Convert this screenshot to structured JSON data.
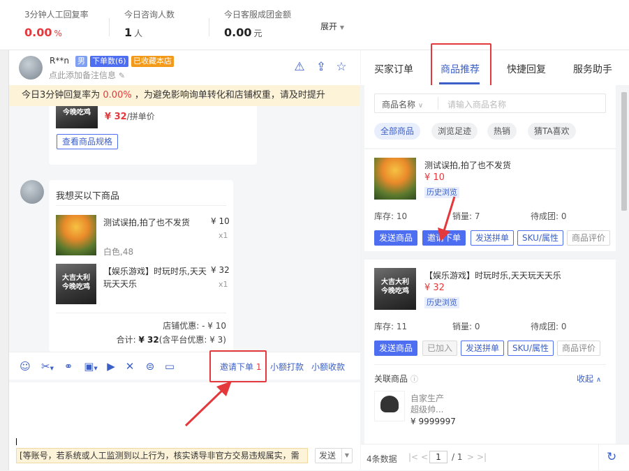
{
  "stats": [
    {
      "label": "3分钟人工回复率",
      "value": "0.00",
      "unit": "%"
    },
    {
      "label": "今日咨询人数",
      "value": "1",
      "unit": "人"
    },
    {
      "label": "今日客服成团金额",
      "value": "0.00",
      "unit": "元"
    }
  ],
  "expand_label": "展开",
  "chat": {
    "username": "R**n",
    "tags": {
      "gender": "男",
      "orders": "下单数(6)",
      "fav": "已收藏本店"
    },
    "note_placeholder": "点此添加备注信息",
    "warning": {
      "prefix": "今日3分钟回复率为 ",
      "rate": "0.00%",
      "suffix": " ，为避免影响询单转化和店铺权重，请及时提升"
    },
    "prev_card": {
      "price": "¥ 32",
      "price_suffix": "/拼单价",
      "spec_btn": "查看商品规格"
    },
    "order_msg": {
      "title": "我想买以下商品",
      "items": [
        {
          "name": "测试误拍,拍了也不发货",
          "price": "¥ 10",
          "qty": "x1",
          "sku": "白色,48"
        },
        {
          "name": "【娱乐游戏】时玩时乐,天天玩天天乐",
          "price": "¥ 32",
          "qty": "x1",
          "sku": ""
        }
      ],
      "discount": "店铺优惠: - ¥ 10",
      "total_prefix": "合计: ",
      "total_value": "¥ 32",
      "total_suffix": "(含平台优惠: ¥ 3)"
    },
    "toolbar": {
      "invite_label": "邀请下单",
      "invite_count": "1",
      "small_pay": "小额打款",
      "small_collect": "小额收款"
    },
    "bottom_warning": "[等账号，若系统或人工监测到以上行为，核实诱导非官方交易违规属实，需",
    "send_label": "发送"
  },
  "right": {
    "tabs": [
      "买家订单",
      "商品推荐",
      "快捷回复",
      "服务助手"
    ],
    "active_tab": "商品推荐",
    "search": {
      "select_label": "商品名称",
      "placeholder": "请输入商品名称"
    },
    "chips": [
      "全部商品",
      "浏览足迹",
      "热销",
      "猜TA喜欢"
    ],
    "products": [
      {
        "title": "测试误拍,拍了也不发货",
        "price": "¥ 10",
        "tag": "历史浏览",
        "stock": "库存: 10",
        "sales": "销量: 7",
        "pending": "待成团: 0",
        "buttons": [
          "发送商品",
          "邀请下单",
          "发送拼单",
          "SKU/属性",
          "商品评价"
        ]
      },
      {
        "title": "【娱乐游戏】时玩时乐,天天玩天天乐",
        "price": "¥ 32",
        "tag": "历史浏览",
        "stock": "库存: 11",
        "sales": "销量: 0",
        "pending": "待成团: 0",
        "buttons": [
          "发送商品",
          "已加入",
          "发送拼单",
          "SKU/属性",
          "商品评价"
        ]
      }
    ],
    "related": {
      "label": "关联商品",
      "collapse": "收起",
      "item_name_1": "自家生产",
      "item_name_2": "超级帅...",
      "item_price": "¥ 9999997"
    },
    "pager": {
      "count": "4条数据",
      "page": "1",
      "total": "/ 1"
    }
  },
  "game_thumb_text": "大吉大利\n今晚吃鸡",
  "colors": {
    "accent": "#3b5fc6",
    "red": "#e4393c",
    "warning_bg": "#fdf3d8"
  }
}
